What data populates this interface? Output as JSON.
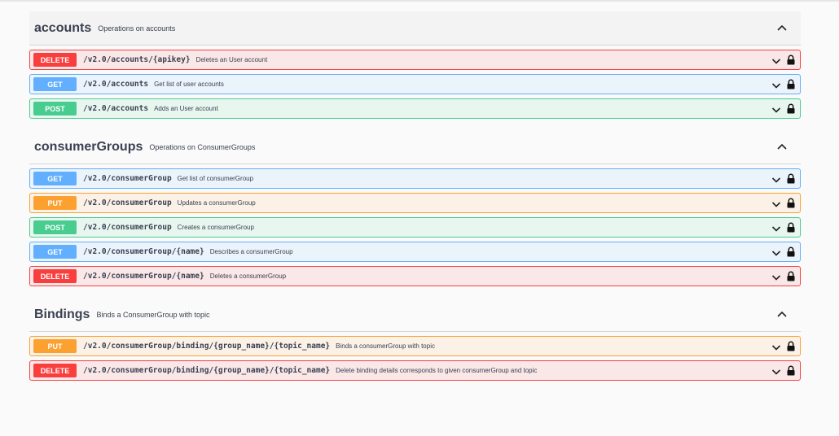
{
  "tags": [
    {
      "name": "accounts",
      "description": "Operations on accounts",
      "operations": [
        {
          "method": "DELETE",
          "kind": "delete",
          "path": "/v2.0/accounts/{apikey}",
          "summary": "Deletes an User account"
        },
        {
          "method": "GET",
          "kind": "get",
          "path": "/v2.0/accounts",
          "summary": "Get list of user accounts"
        },
        {
          "method": "POST",
          "kind": "post",
          "path": "/v2.0/accounts",
          "summary": "Adds an User account"
        }
      ]
    },
    {
      "name": "consumerGroups",
      "description": "Operations on ConsumerGroups",
      "operations": [
        {
          "method": "GET",
          "kind": "get",
          "path": "/v2.0/consumerGroup",
          "summary": "Get list of consumerGroup"
        },
        {
          "method": "PUT",
          "kind": "put",
          "path": "/v2.0/consumerGroup",
          "summary": "Updates a consumerGroup"
        },
        {
          "method": "POST",
          "kind": "post",
          "path": "/v2.0/consumerGroup",
          "summary": "Creates a consumerGroup"
        },
        {
          "method": "GET",
          "kind": "get",
          "path": "/v2.0/consumerGroup/{name}",
          "summary": "Describes a consumerGroup"
        },
        {
          "method": "DELETE",
          "kind": "delete",
          "path": "/v2.0/consumerGroup/{name}",
          "summary": "Deletes a consumerGroup"
        }
      ]
    },
    {
      "name": "Bindings",
      "description": "Binds a ConsumerGroup with topic",
      "operations": [
        {
          "method": "PUT",
          "kind": "put",
          "path": "/v2.0/consumerGroup/binding/{group_name}/{topic_name}",
          "summary": "Binds a consumerGroup with topic"
        },
        {
          "method": "DELETE",
          "kind": "delete",
          "path": "/v2.0/consumerGroup/binding/{group_name}/{topic_name}",
          "summary": "Delete binding details corresponds to given consumerGroup and topic"
        }
      ]
    }
  ],
  "icons": {
    "tag_toggle": "chevron-up-icon",
    "op_toggle": "chevron-down-icon",
    "auth": "lock-icon"
  },
  "colors": {
    "get": "#61affe",
    "post": "#49cc90",
    "put": "#fca130",
    "delete": "#f93e3e",
    "text": "#3b4151"
  }
}
